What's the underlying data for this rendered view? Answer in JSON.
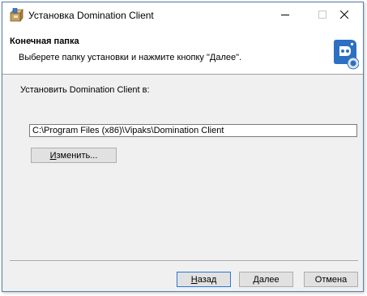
{
  "window": {
    "title": "Установка Domination Client"
  },
  "header": {
    "title": "Конечная папка",
    "subtitle": "Выберете папку установки и нажмите кнопку \"Далее\"."
  },
  "main": {
    "install_label": "Установить Domination Client в:",
    "path_value": "C:\\Program Files (x86)\\Vipaks\\Domination Client",
    "change_button": {
      "underlined": "И",
      "rest": "зменить..."
    }
  },
  "footer": {
    "back_button": {
      "underlined": "Н",
      "rest": "азад"
    },
    "next_button": {
      "underlined": "Д",
      "rest": "алее"
    },
    "cancel_button": "Отмена"
  },
  "icons": {
    "app": "installer-box-icon",
    "logo": "domination-client-logo",
    "minimize": "minimize-icon",
    "maximize": "maximize-icon",
    "close": "close-icon"
  },
  "colors": {
    "logo_blue": "#2d6fc2",
    "default_button_border": "#2b78d3"
  }
}
